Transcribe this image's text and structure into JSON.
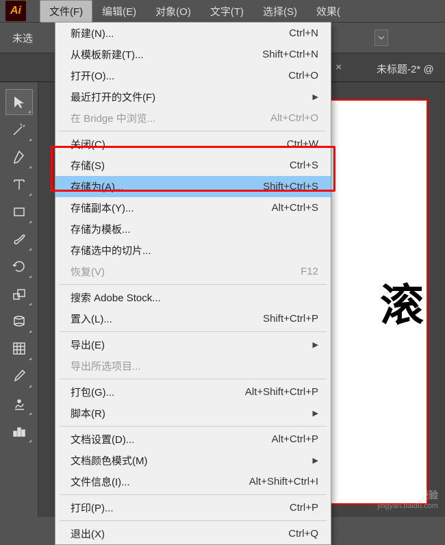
{
  "app": {
    "logo_text": "Ai"
  },
  "menubar": {
    "items": [
      {
        "label": "文件(F)",
        "active": true
      },
      {
        "label": "编辑(E)"
      },
      {
        "label": "对象(O)"
      },
      {
        "label": "文字(T)"
      },
      {
        "label": "选择(S)"
      },
      {
        "label": "效果("
      }
    ]
  },
  "toolbar": {
    "selection_label": "未选"
  },
  "tabs": {
    "doc_title": "未标题-2* @",
    "close": "×"
  },
  "dropdown": {
    "items": [
      {
        "label": "新建(N)...",
        "shortcut": "Ctrl+N"
      },
      {
        "label": "从模板新建(T)...",
        "shortcut": "Shift+Ctrl+N"
      },
      {
        "label": "打开(O)...",
        "shortcut": "Ctrl+O"
      },
      {
        "label": "最近打开的文件(F)",
        "submenu": true
      },
      {
        "label": "在 Bridge 中浏览...",
        "shortcut": "Alt+Ctrl+O",
        "disabled": true
      },
      {
        "sep": true
      },
      {
        "label": "关闭(C)",
        "shortcut": "Ctrl+W"
      },
      {
        "label": "存储(S)",
        "shortcut": "Ctrl+S"
      },
      {
        "label": "存储为(A)...",
        "shortcut": "Shift+Ctrl+S",
        "highlight": true
      },
      {
        "label": "存储副本(Y)...",
        "shortcut": "Alt+Ctrl+S"
      },
      {
        "label": "存储为模板..."
      },
      {
        "label": "存储选中的切片..."
      },
      {
        "label": "恢复(V)",
        "shortcut": "F12",
        "disabled": true
      },
      {
        "sep": true
      },
      {
        "label": "搜索 Adobe Stock..."
      },
      {
        "label": "置入(L)...",
        "shortcut": "Shift+Ctrl+P"
      },
      {
        "sep": true
      },
      {
        "label": "导出(E)",
        "submenu": true
      },
      {
        "label": "导出所选项目...",
        "disabled": true
      },
      {
        "sep": true
      },
      {
        "label": "打包(G)...",
        "shortcut": "Alt+Shift+Ctrl+P"
      },
      {
        "label": "脚本(R)",
        "submenu": true
      },
      {
        "sep": true
      },
      {
        "label": "文档设置(D)...",
        "shortcut": "Alt+Ctrl+P"
      },
      {
        "label": "文档颜色模式(M)",
        "submenu": true
      },
      {
        "label": "文件信息(I)...",
        "shortcut": "Alt+Shift+Ctrl+I"
      },
      {
        "sep": true
      },
      {
        "label": "打印(P)...",
        "shortcut": "Ctrl+P"
      },
      {
        "sep": true
      },
      {
        "label": "退出(X)",
        "shortcut": "Ctrl+Q"
      }
    ]
  },
  "tools": [
    "selection",
    "magic-wand",
    "pen",
    "type",
    "rectangle",
    "brush",
    "rotate",
    "scale",
    "warp",
    "grid",
    "eyedropper",
    "symbol",
    "column-graph"
  ],
  "artboard": {
    "text": "滚"
  },
  "watermark": {
    "brand": "Baidu 经验",
    "url": "jingyan.baidu.com"
  }
}
